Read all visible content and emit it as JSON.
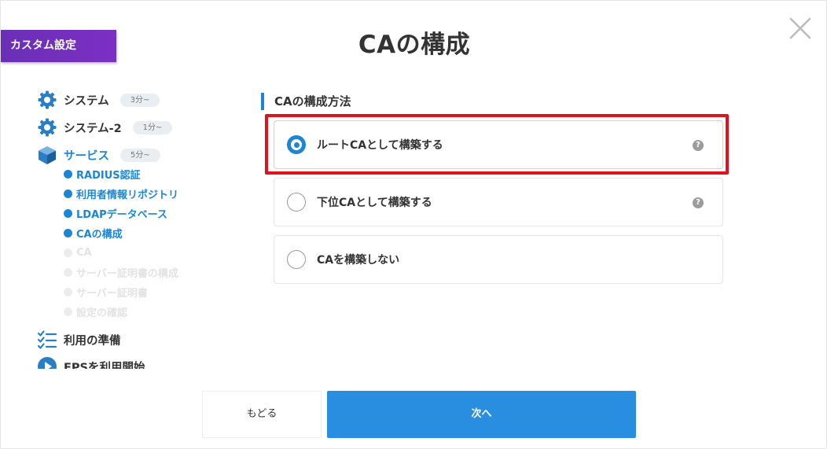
{
  "badge": "カスタム設定",
  "title": "CAの構成",
  "sidebar": {
    "sections": [
      {
        "label": "システム",
        "duration": "3分~"
      },
      {
        "label": "システム-2",
        "duration": "1分~"
      },
      {
        "label": "サービス",
        "duration": "5分~"
      },
      {
        "label": "利用の準備"
      },
      {
        "label": "EPSを利用開始"
      }
    ],
    "service_steps": [
      {
        "label": "RADIUS認証",
        "state": "done"
      },
      {
        "label": "利用者情報リポジトリ",
        "state": "done"
      },
      {
        "label": "LDAPデータベース",
        "state": "done"
      },
      {
        "label": "CAの構成",
        "state": "current"
      },
      {
        "label": "CA",
        "state": "pending"
      },
      {
        "label": "サーバー証明書の構成",
        "state": "pending"
      },
      {
        "label": "サーバー証明書",
        "state": "pending"
      },
      {
        "label": "設定の確認",
        "state": "pending"
      }
    ]
  },
  "main": {
    "section_title": "CAの構成方法",
    "options": [
      {
        "label": "ルートCAとして構築する",
        "selected": true,
        "help": "?"
      },
      {
        "label": "下位CAとして構築する",
        "selected": false,
        "help": "?"
      },
      {
        "label": "CAを構築しない",
        "selected": false
      }
    ]
  },
  "footer": {
    "back_label": "もどる",
    "next_label": "次へ"
  },
  "colors": {
    "accent": "#1d86d4",
    "badge": "#7130bf",
    "highlight": "#e0121b",
    "primary_button": "#2a8ee0"
  }
}
